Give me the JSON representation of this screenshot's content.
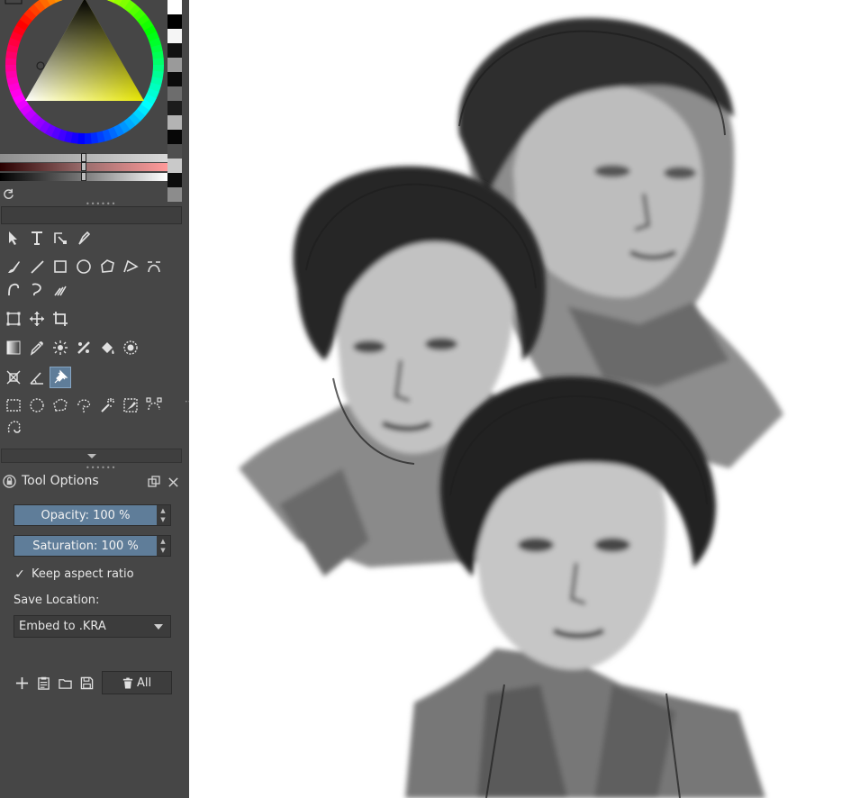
{
  "color_selector": {
    "wheel": "hue-wheel",
    "triangle": "saturation-value-triangle",
    "swatches": [
      "#ffffff",
      "#000000",
      "#f5f5f5",
      "#111111",
      "#9a9a9a",
      "#0b0b0b",
      "#6d6d6d",
      "#1c1c1c",
      "#b3b3b3",
      "#070707",
      "#4f4f4f",
      "#c9c9c9",
      "#0d0d0d",
      "#8c8c8c"
    ],
    "refresh_icon": "refresh-icon"
  },
  "toolbox": {
    "rows": [
      [
        "select-shapes-icon",
        "text-icon",
        "edit-shapes-icon",
        "calligraphy-icon"
      ],
      [
        "freehand-brush-icon",
        "line-icon",
        "rectangle-icon",
        "ellipse-icon",
        "polygon-icon",
        "polyline-icon",
        "bezier-icon"
      ],
      [
        "freehand-path-icon",
        "dynamic-brush-icon",
        "multibrush-icon"
      ],
      [
        "transform-icon",
        "move-icon",
        "crop-icon"
      ],
      [
        "gradient-icon",
        "color-picker-icon",
        "smart-patch-icon",
        "pattern-icon",
        "fill-icon",
        "enclose-fill-icon"
      ],
      [
        "assistant-icon",
        "measure-icon",
        "reference-images-icon"
      ],
      [
        "rect-select-icon",
        "ellipse-select-icon",
        "polygon-select-icon",
        "freehand-select-icon",
        "contiguous-select-icon",
        "similar-select-icon",
        "bezier-select-icon"
      ],
      [
        "magnetic-select-icon"
      ]
    ],
    "active_tool": "reference-images-icon"
  },
  "tool_options": {
    "title": "Tool Options",
    "opacity": {
      "label": "Opacity:",
      "value": "100 %",
      "fraction": 1.0
    },
    "saturation": {
      "label": "Saturation:",
      "value": "100 %",
      "fraction": 1.0
    },
    "keep_aspect_ratio": {
      "label": "Keep aspect ratio",
      "checked": true
    },
    "save_location_label": "Save Location:",
    "save_location_value": "Embed to .KRA",
    "delete_all_label": "All"
  },
  "colors": {
    "panel_bg": "#464646",
    "accent": "#5f7d99",
    "text": "#e6e6e6",
    "canvas_bg": "#ffffff"
  }
}
